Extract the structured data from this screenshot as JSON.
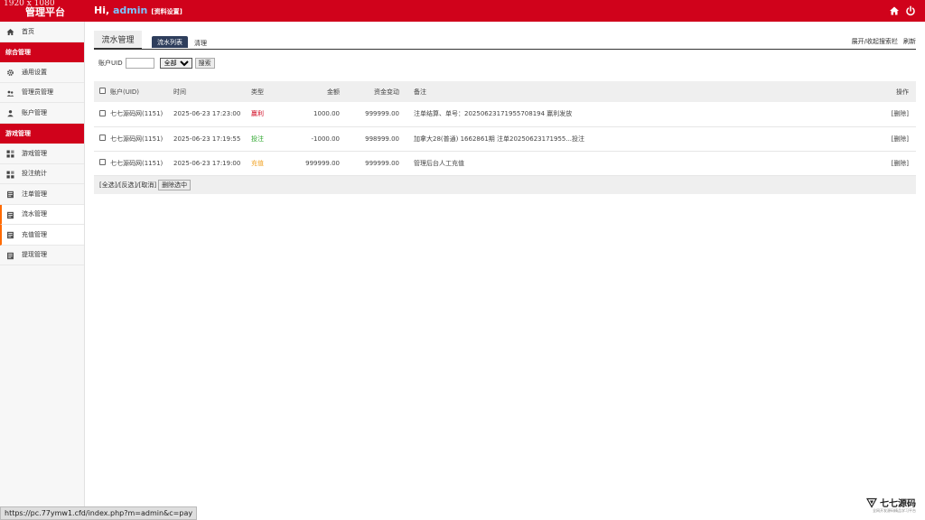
{
  "overlay": {
    "resolution": "1920 x 1080"
  },
  "header": {
    "brand": "管理平台",
    "greeting_prefix": "Hi, ",
    "username": "admin",
    "profile_link": "[资料设置]",
    "icons": [
      "home-icon",
      "power-icon"
    ]
  },
  "sidebar": {
    "items": [
      {
        "type": "item",
        "label": "首页",
        "icon": "home-icon"
      },
      {
        "type": "section",
        "label": "综合管理"
      },
      {
        "type": "item",
        "label": "通用设置",
        "icon": "gear-icon"
      },
      {
        "type": "item",
        "label": "管理员管理",
        "icon": "users-icon"
      },
      {
        "type": "item",
        "label": "账户管理",
        "icon": "user-icon"
      },
      {
        "type": "section",
        "label": "游戏管理"
      },
      {
        "type": "item",
        "label": "游戏管理",
        "icon": "grid-icon"
      },
      {
        "type": "item",
        "label": "投注统计",
        "icon": "grid-icon"
      },
      {
        "type": "item",
        "label": "注单管理",
        "icon": "doc-icon"
      },
      {
        "type": "item",
        "label": "流水管理",
        "icon": "doc-icon",
        "active": true
      },
      {
        "type": "item",
        "label": "充值管理",
        "icon": "doc-icon",
        "active": true
      },
      {
        "type": "item",
        "label": "提现管理",
        "icon": "doc-icon"
      }
    ]
  },
  "tabs": {
    "main": "流水管理",
    "active_pill": "流水列表",
    "link": "清理",
    "right": [
      "展开/收起搜索栏",
      "刷新"
    ]
  },
  "filter": {
    "uid_label": "账户UID",
    "uid_value": "",
    "select_value": "全部",
    "search_button": "搜索"
  },
  "table": {
    "headers": {
      "account": "账户(UID)",
      "time": "时间",
      "type": "类型",
      "amount": "金额",
      "balance": "资金变动",
      "note": "备注",
      "op": "操作"
    },
    "rows": [
      {
        "account": "七七源码网(1151)",
        "time": "2025-06-23 17:23:00",
        "type": "赢利",
        "type_class": "t-profit",
        "amount": "1000.00",
        "balance": "999999.00",
        "note": "注单结算、单号：2025062317195570819​4 赢利发放",
        "op": "[删除]"
      },
      {
        "account": "七七源码网(1151)",
        "time": "2025-06-23 17:19:55",
        "type": "投注",
        "type_class": "t-bet",
        "amount": "-1000.00",
        "balance": "998999.00",
        "note": "加拿大28(普通) 1662861期 注单20250623171955...投注",
        "op": "[删除]"
      },
      {
        "account": "七七源码网(1151)",
        "time": "2025-06-23 17:19:00",
        "type": "充值",
        "type_class": "t-charge",
        "amount": "999999.00",
        "balance": "999999.00",
        "note": "管理后台人工充值",
        "op": "[删除]"
      }
    ]
  },
  "footer_actions": {
    "select_links": "[全选]/[反选]/[取消]",
    "delete_button": "删除选中"
  },
  "watermark": {
    "text": "七七源码",
    "sub": "全网开发源码精品学习平台"
  },
  "statusbar": {
    "url": "https://pc.77ymw1.cfd/index.php?m=admin&c=pay"
  },
  "colors": {
    "brand_red": "#d0021b",
    "active_accent": "#ff6a00",
    "pill_navy": "#2e3e5c"
  }
}
